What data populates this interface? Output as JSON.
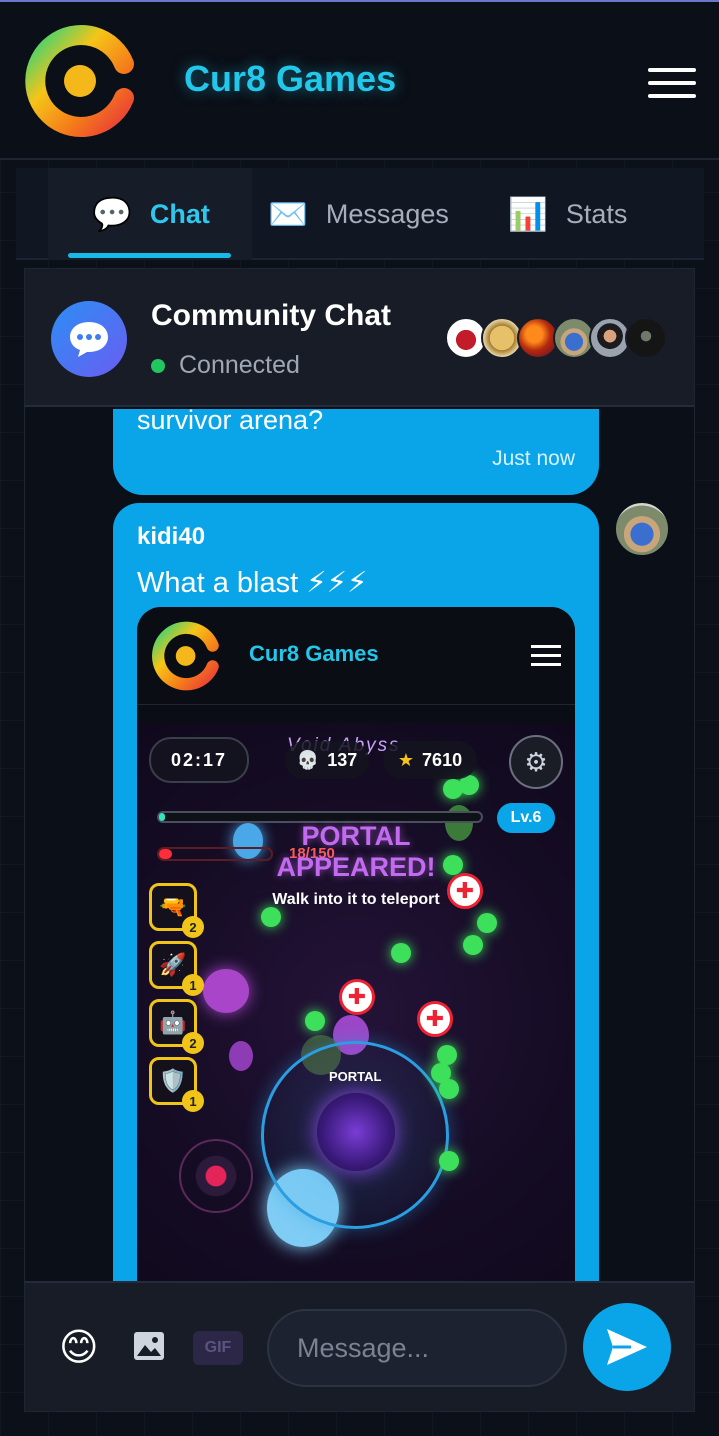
{
  "app": {
    "brand": "Cur8 Games",
    "accent": "#22c7ea",
    "logo_icon": "cur8-logo-icon",
    "menu_icon": "hamburger-menu-icon"
  },
  "tabs": [
    {
      "label": "Chat",
      "icon": "speech-bubble-icon",
      "active": true
    },
    {
      "label": "Messages",
      "icon": "envelope-icon",
      "active": false
    },
    {
      "label": "Stats",
      "icon": "bar-chart-icon",
      "active": false
    }
  ],
  "chat": {
    "title": "Community Chat",
    "status": "Connected",
    "status_color": "#22c55e",
    "online_avatars": 6
  },
  "messages": [
    {
      "text": "survivor arena?",
      "time": "Just now"
    },
    {
      "user": "kidi40",
      "text": "What a blast ⚡⚡⚡",
      "attachment": "game-screenshot"
    }
  ],
  "embedded_game": {
    "brand": "Cur8 Games",
    "timer": "02:17",
    "level_name": "Void Abyss",
    "kills": "137",
    "score": "7610",
    "level": "Lv.6",
    "hp": "18/150",
    "hp_fraction": 0.12,
    "xp_fraction": 0.02,
    "portal_title_1": "PORTAL",
    "portal_title_2": "APPEARED!",
    "portal_sub": "Walk into it to teleport",
    "portal_label": "PORTAL",
    "inventory": [
      {
        "icon": "gun-icon",
        "glyph": "🔫",
        "count": "2"
      },
      {
        "icon": "rocket-icon",
        "glyph": "🚀",
        "count": "1"
      },
      {
        "icon": "robot-icon",
        "glyph": "🤖",
        "count": "2"
      },
      {
        "icon": "shield-icon",
        "glyph": "🛡️",
        "count": "1"
      }
    ]
  },
  "composer": {
    "placeholder": "Message...",
    "gif_label": "GIF",
    "emoji_glyph": "😊"
  }
}
